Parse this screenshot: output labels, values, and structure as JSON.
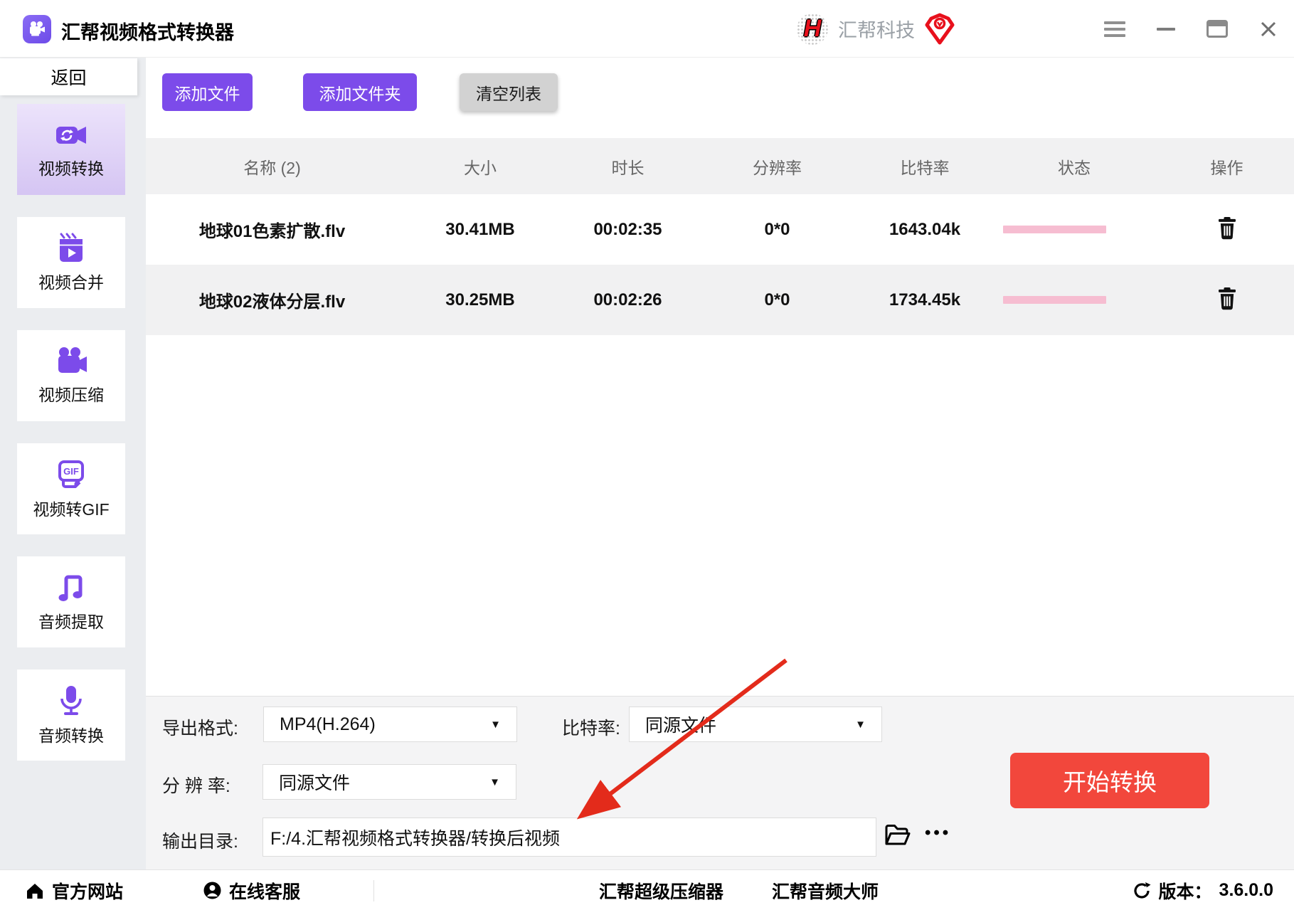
{
  "window": {
    "title": "汇帮视频格式转换器",
    "brand_name": "汇帮科技"
  },
  "sidebar": {
    "back_label": "返回",
    "items": [
      {
        "label": "视频转换",
        "icon": "video-convert-icon",
        "active": true
      },
      {
        "label": "视频合并",
        "icon": "video-merge-icon",
        "active": false
      },
      {
        "label": "视频压缩",
        "icon": "video-compress-icon",
        "active": false
      },
      {
        "label": "视频转GIF",
        "icon": "video-to-gif-icon",
        "active": false
      },
      {
        "label": "音频提取",
        "icon": "audio-extract-icon",
        "active": false
      },
      {
        "label": "音频转换",
        "icon": "audio-convert-icon",
        "active": false
      }
    ]
  },
  "toolbar": {
    "add_file": "添加文件",
    "add_folder": "添加文件夹",
    "clear_list": "清空列表"
  },
  "table": {
    "headers": [
      "名称 (2)",
      "大小",
      "时长",
      "分辨率",
      "比特率",
      "状态",
      "操作"
    ],
    "rows": [
      {
        "name": "地球01色素扩散.flv",
        "size": "30.41MB",
        "duration": "00:02:35",
        "resolution": "0*0",
        "bitrate": "1643.04k",
        "status_progress": 0
      },
      {
        "name": "地球02液体分层.flv",
        "size": "30.25MB",
        "duration": "00:02:26",
        "resolution": "0*0",
        "bitrate": "1734.45k",
        "status_progress": 0
      }
    ]
  },
  "settings": {
    "export_format_label": "导出格式:",
    "export_format_value": "MP4(H.264)",
    "bitrate_label": "比特率:",
    "bitrate_value": "同源文件",
    "resolution_label": "分 辨 率:",
    "resolution_value": "同源文件",
    "output_dir_label": "输出目录:",
    "output_dir_value": "F:/4.汇帮视频格式转换器/转换后视频",
    "dots_label": "•••",
    "start_button": "开始转换"
  },
  "footer": {
    "official_site": "官方网站",
    "online_support": "在线客服",
    "super_compressor": "汇帮超级压缩器",
    "audio_master": "汇帮音频大师",
    "version_label": "版本：",
    "version": "3.6.0.0"
  },
  "colors": {
    "accent_purple": "#7c4bea",
    "active_item_gradient_top": "#ece3fb",
    "active_item_gradient_bottom": "#d5c5f3",
    "start_button_red": "#f2473c",
    "progress_pink": "#f6bdd1",
    "annotation_arrow_red": "#e32b1b",
    "brand_red": "#e8101c",
    "row_alt_gray": "#f1f1f2"
  }
}
